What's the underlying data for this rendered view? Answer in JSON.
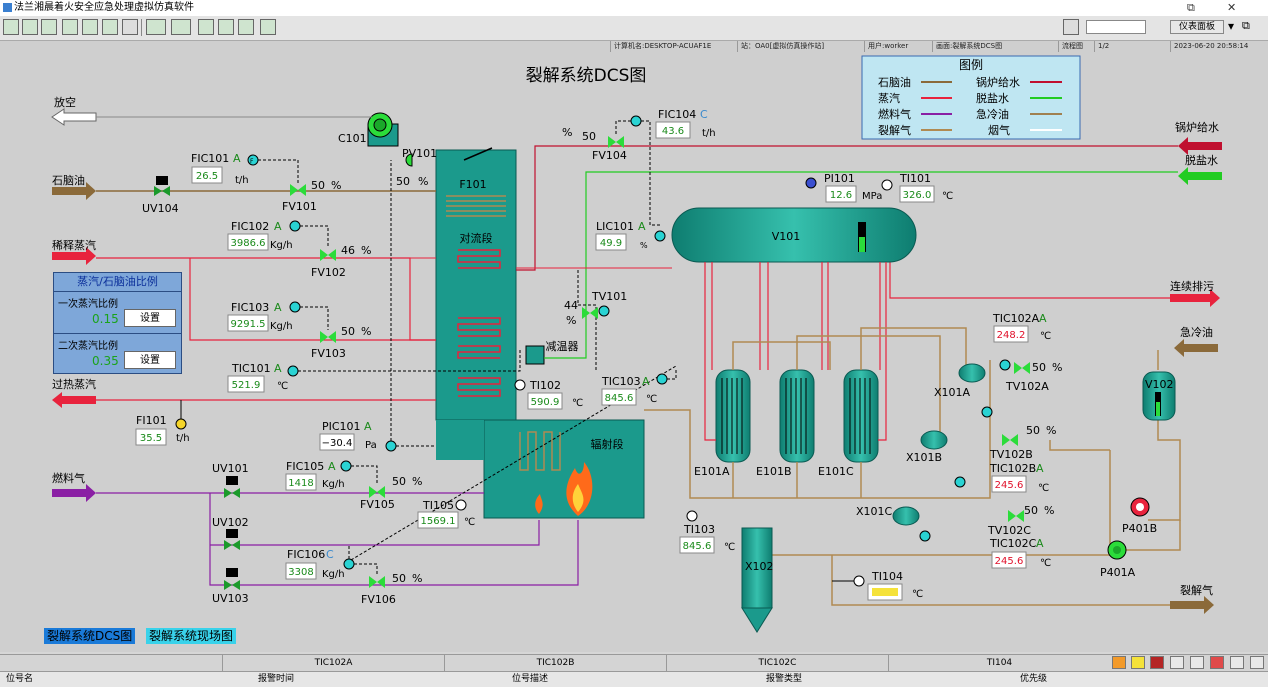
{
  "window": {
    "title": "法兰湘晨着火安全应急处理虚拟仿真软件"
  },
  "toolbar": {
    "search_value": "",
    "dropdown_label": "仪表面板"
  },
  "status": {
    "computer": "计算机名:DESKTOP-ACUAF1E",
    "station": "站：OA0[虚拟仿真操作站]",
    "user": "用户:worker",
    "screen": "画面:裂解系统DCS图",
    "flowchart": "流程图",
    "page": "1/2",
    "datetime": "2023-06-20 20:58:14"
  },
  "diagram": {
    "title": "裂解系统DCS图",
    "legend": {
      "title": "图例",
      "items": [
        {
          "label": "石脑油",
          "color": "#8b6a3a"
        },
        {
          "label": "锅炉给水",
          "color": "#c0102f"
        },
        {
          "label": "蒸汽",
          "color": "#e8233d"
        },
        {
          "label": "脱盐水",
          "color": "#22cc22"
        },
        {
          "label": "燃料气",
          "color": "#8a1fa4"
        },
        {
          "label": "急冷油",
          "color": "#a08050"
        },
        {
          "label": "裂解气",
          "color": "#b08a52"
        },
        {
          "label": "烟气",
          "color": "#ffffff"
        }
      ]
    },
    "streams": {
      "vent": "放空",
      "naphtha": "石脑油",
      "dilution_steam": "稀释蒸汽",
      "superheated_steam": "过热蒸汽",
      "fuel_gas": "燃料气",
      "boiler_feed_water": "锅炉给水",
      "desalted_water": "脱盐水",
      "continuous_blowdown": "连续排污",
      "quench_oil": "急冷油",
      "cracked_gas": "裂解气"
    },
    "equipment": {
      "c101": "C101",
      "f101": "F101",
      "convection": "对流段",
      "radiant": "辐射段",
      "desuperheater": "减温器",
      "v101": "V101",
      "v102": "V102",
      "x102": "X102",
      "e101a": "E101A",
      "e101b": "E101B",
      "e101c": "E101C",
      "x101a": "X101A",
      "x101b": "X101B",
      "x101c": "X101C",
      "p401a": "P401A",
      "p401b": "P401B",
      "uv104": "UV104",
      "uv101": "UV101",
      "uv102": "UV102",
      "uv103": "UV103"
    },
    "instruments": {
      "fic101": {
        "tag": "FIC101",
        "mode": "A",
        "value": "26.5",
        "unit": "t/h",
        "valve": "FV101",
        "pct": "50",
        "pct_unit": "%"
      },
      "fic102": {
        "tag": "FIC102",
        "mode": "A",
        "value": "3986.6",
        "unit": "Kg/h",
        "valve": "FV102",
        "pct": "46",
        "pct_unit": "%"
      },
      "fic103": {
        "tag": "FIC103",
        "mode": "A",
        "value": "9291.5",
        "unit": "Kg/h",
        "valve": "FV103",
        "pct": "50",
        "pct_unit": "%"
      },
      "tic101": {
        "tag": "TIC101",
        "mode": "A",
        "value": "521.9",
        "unit": "℃"
      },
      "fi101": {
        "tag": "FI101",
        "value": "35.5",
        "unit": "t/h"
      },
      "pic101": {
        "tag": "PIC101",
        "mode": "A",
        "value": "−30.4",
        "unit": "Pa"
      },
      "pv101": {
        "tag": "PV101",
        "pct": "50",
        "pct_unit": "%"
      },
      "fic105": {
        "tag": "FIC105",
        "mode": "A",
        "value": "1418",
        "unit": "Kg/h",
        "valve": "FV105",
        "pct": "50",
        "pct_unit": "%"
      },
      "fic106": {
        "tag": "FIC106",
        "mode": "C",
        "value": "3308",
        "unit": "Kg/h",
        "valve": "FV106",
        "pct": "50",
        "pct_unit": "%"
      },
      "ti105": {
        "tag": "TI105",
        "value": "1569.1",
        "unit": "℃"
      },
      "ti102": {
        "tag": "TI102",
        "value": "590.9",
        "unit": "℃"
      },
      "tic103": {
        "tag": "TIC103",
        "mode": "A",
        "value": "845.6",
        "unit": "℃"
      },
      "fic104": {
        "tag": "FIC104",
        "mode": "C",
        "value": "43.6",
        "unit": "t/h",
        "valve": "FV104",
        "pct": "50",
        "pct_unit": "%"
      },
      "lic101": {
        "tag": "LIC101",
        "mode": "A",
        "value": "49.9",
        "unit": "%"
      },
      "tv101": {
        "tag": "TV101",
        "pct": "44",
        "pct_unit": "%"
      },
      "pi101": {
        "tag": "PI101",
        "value": "12.6",
        "unit": "MPa"
      },
      "ti101": {
        "tag": "TI101",
        "value": "326.0",
        "unit": "℃"
      },
      "ti103": {
        "tag": "TI103",
        "value": "845.6",
        "unit": "℃"
      },
      "ti104": {
        "tag": "TI104",
        "value": "",
        "unit": "℃"
      },
      "tic102a": {
        "tag": "TIC102A",
        "mode": "A",
        "value": "248.2",
        "unit": "℃",
        "valve": "TV102A",
        "pct": "50",
        "pct_unit": "%"
      },
      "tic102b": {
        "tag": "TIC102B",
        "mode": "A",
        "value": "245.6",
        "unit": "℃",
        "valve": "TV102B",
        "pct": "50",
        "pct_unit": "%"
      },
      "tic102c": {
        "tag": "TIC102C",
        "mode": "A",
        "value": "245.6",
        "unit": "℃",
        "valve": "TV102C",
        "pct": "50",
        "pct_unit": "%"
      }
    },
    "ratio_panel": {
      "title": "蒸汽/石脑油比例",
      "rows": [
        {
          "label": "一次蒸汽比例",
          "value": "0.15",
          "button": "设置"
        },
        {
          "label": "二次蒸汽比例",
          "value": "0.35",
          "button": "设置"
        }
      ]
    }
  },
  "nav": {
    "dcs": "裂解系统DCS图",
    "field": "裂解系统现场图"
  },
  "alarms": {
    "tags": [
      "TIC102A",
      "TIC102B",
      "TIC102C",
      "TI104"
    ],
    "headers": [
      "位号名",
      "报警时间",
      "位号描述",
      "报警类型",
      "优先级"
    ]
  },
  "colors": {
    "equipment": "#1b9a8c",
    "naphtha": "#8b6a3a",
    "steam": "#e8233d",
    "fuel": "#8a1fa4",
    "water": "#22cc22",
    "cracked": "#b08a52",
    "value_green": "#1a8a1a",
    "value_red": "#e0102a"
  }
}
